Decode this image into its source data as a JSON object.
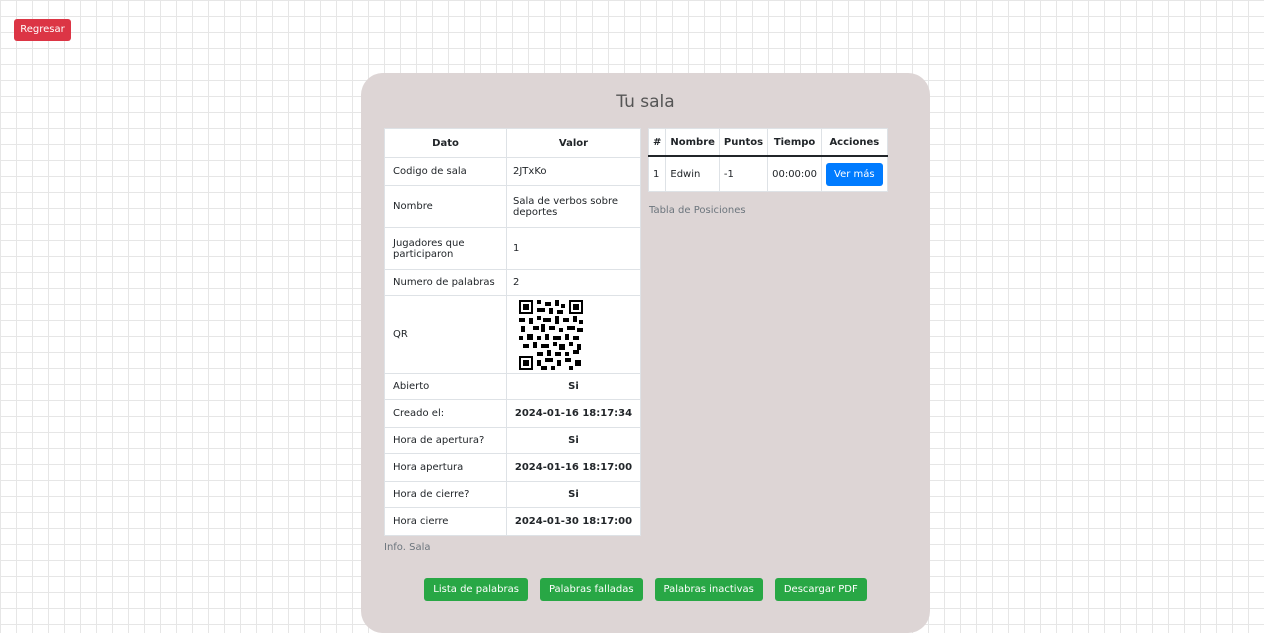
{
  "back_button": "Regresar",
  "card": {
    "title": "Tu sala"
  },
  "info_table": {
    "headers": [
      "Dato",
      "Valor"
    ],
    "rows": [
      {
        "label": "Codigo de sala",
        "value": "2JTxKo"
      },
      {
        "label": "Nombre",
        "value": "Sala de verbos sobre deportes"
      },
      {
        "label": "Jugadores que participaron",
        "value": "1"
      },
      {
        "label": "Numero de palabras",
        "value": "2"
      },
      {
        "label": "QR",
        "value": ""
      },
      {
        "label": "Abierto",
        "value": "Si"
      },
      {
        "label": "Creado el:",
        "value": "2024-01-16 18:17:34"
      },
      {
        "label": "Hora de apertura?",
        "value": "Si"
      },
      {
        "label": "Hora apertura",
        "value": "2024-01-16 18:17:00"
      },
      {
        "label": "Hora de cierre?",
        "value": "Si"
      },
      {
        "label": "Hora cierre",
        "value": "2024-01-30 18:17:00"
      }
    ],
    "caption": "Info. Sala"
  },
  "positions_table": {
    "headers": [
      "#",
      "Nombre",
      "Puntos",
      "Tiempo",
      "Acciones"
    ],
    "rows": [
      {
        "rank": "1",
        "name": "Edwin",
        "points": "-1",
        "time": "00:00:00",
        "action": "Ver más"
      }
    ],
    "caption": "Tabla de Posiciones"
  },
  "bottom_buttons": [
    "Lista de palabras",
    "Palabras falladas",
    "Palabras inactivas",
    "Descargar PDF"
  ],
  "colors": {
    "danger": "#dc3545",
    "success": "#28a745",
    "primary": "#007bff",
    "card_bg": "#ddd5d5"
  }
}
